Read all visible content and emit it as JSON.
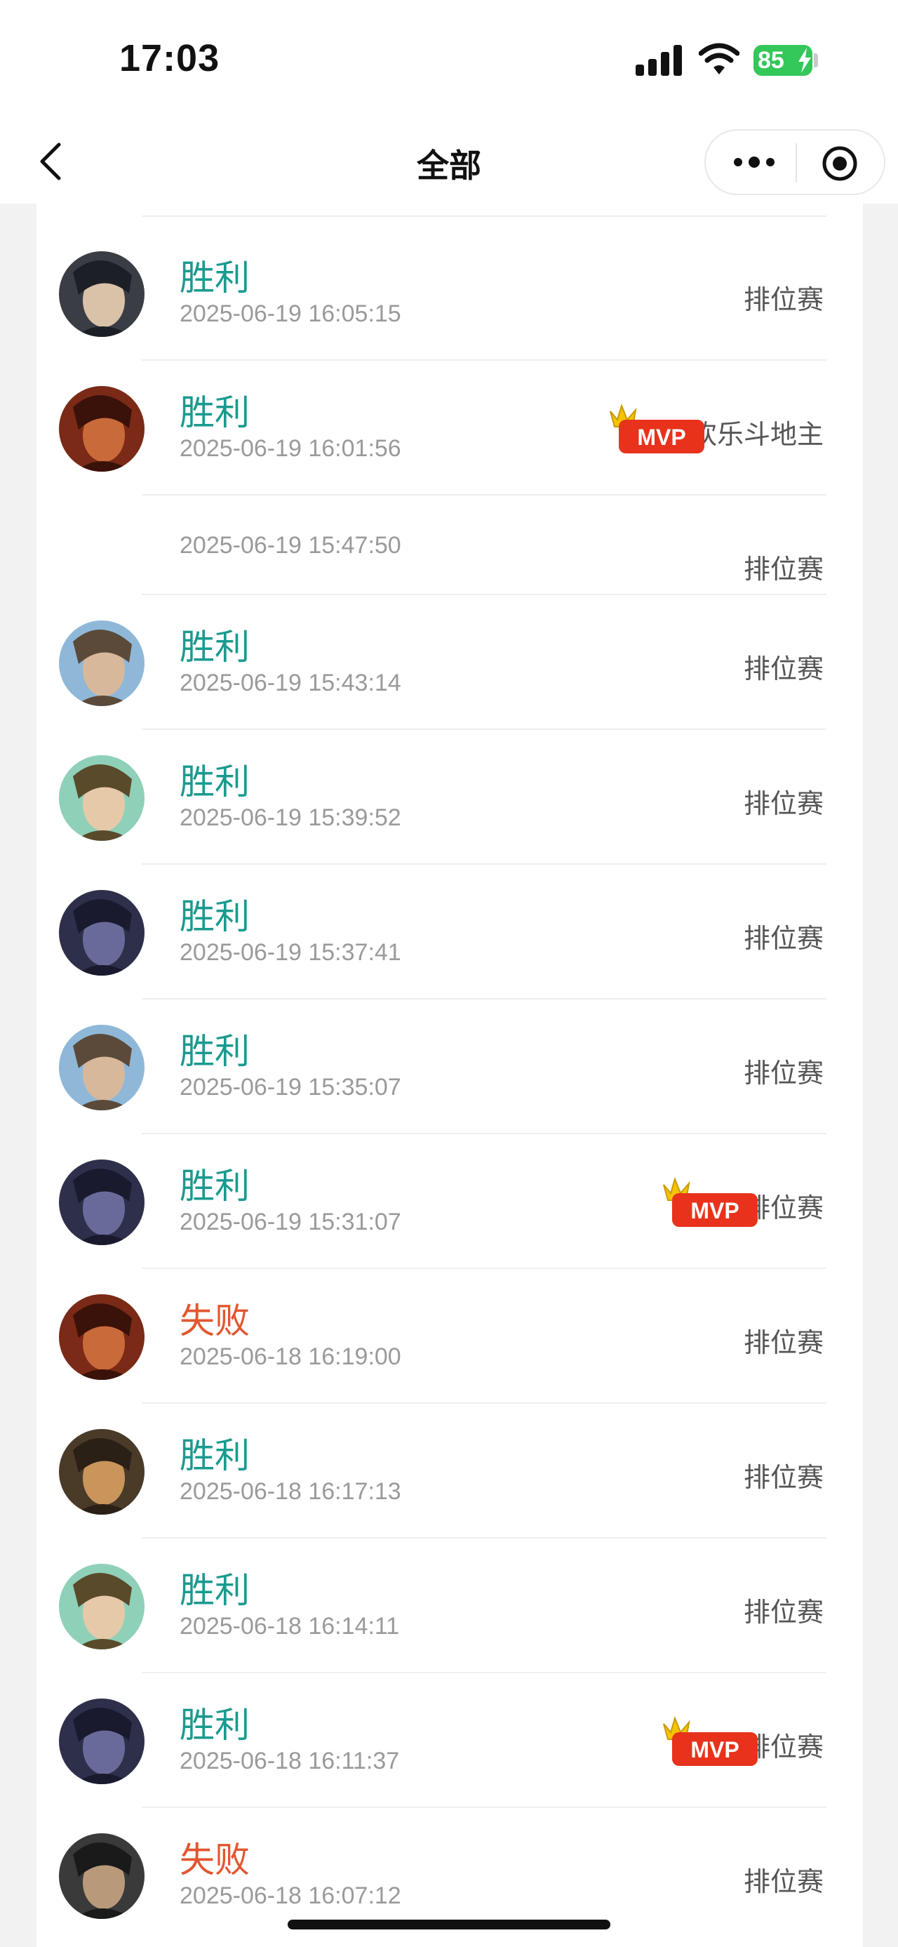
{
  "status_bar": {
    "time": "17:03",
    "battery": "85"
  },
  "navbar": {
    "title": "全部"
  },
  "matches": [
    {
      "avatar": "hero-avatar-1",
      "result": "胜利",
      "result_type": "win",
      "datetime": "2025-06-19 16:05:15",
      "mode": "排位赛",
      "mvp": false
    },
    {
      "avatar": "hero-avatar-2",
      "result": "胜利",
      "result_type": "win",
      "datetime": "2025-06-19 16:01:56",
      "mode": "欢乐斗地主",
      "mvp": true
    },
    {
      "avatar": "",
      "result": "",
      "result_type": "none",
      "datetime": "2025-06-19 15:47:50",
      "mode": "排位赛",
      "mvp": false
    },
    {
      "avatar": "hero-avatar-3",
      "result": "胜利",
      "result_type": "win",
      "datetime": "2025-06-19 15:43:14",
      "mode": "排位赛",
      "mvp": false
    },
    {
      "avatar": "hero-avatar-4",
      "result": "胜利",
      "result_type": "win",
      "datetime": "2025-06-19 15:39:52",
      "mode": "排位赛",
      "mvp": false
    },
    {
      "avatar": "hero-avatar-5",
      "result": "胜利",
      "result_type": "win",
      "datetime": "2025-06-19 15:37:41",
      "mode": "排位赛",
      "mvp": false
    },
    {
      "avatar": "hero-avatar-3",
      "result": "胜利",
      "result_type": "win",
      "datetime": "2025-06-19 15:35:07",
      "mode": "排位赛",
      "mvp": false
    },
    {
      "avatar": "hero-avatar-5",
      "result": "胜利",
      "result_type": "win",
      "datetime": "2025-06-19 15:31:07",
      "mode": "排位赛",
      "mvp": true
    },
    {
      "avatar": "hero-avatar-2",
      "result": "失败",
      "result_type": "lose",
      "datetime": "2025-06-18 16:19:00",
      "mode": "排位赛",
      "mvp": false
    },
    {
      "avatar": "hero-avatar-6",
      "result": "胜利",
      "result_type": "win",
      "datetime": "2025-06-18 16:17:13",
      "mode": "排位赛",
      "mvp": false
    },
    {
      "avatar": "hero-avatar-4",
      "result": "胜利",
      "result_type": "win",
      "datetime": "2025-06-18 16:14:11",
      "mode": "排位赛",
      "mvp": false
    },
    {
      "avatar": "hero-avatar-5",
      "result": "胜利",
      "result_type": "win",
      "datetime": "2025-06-18 16:11:37",
      "mode": "排位赛",
      "mvp": true
    },
    {
      "avatar": "hero-avatar-7",
      "result": "失败",
      "result_type": "lose",
      "datetime": "2025-06-18 16:07:12",
      "mode": "排位赛",
      "mvp": false
    }
  ],
  "mvp_badge": "MVP",
  "colors": {
    "win": "#1a9a8f",
    "lose": "#e2562f",
    "mvp_red": "#e8321c",
    "mvp_gold": "#f5c400"
  }
}
